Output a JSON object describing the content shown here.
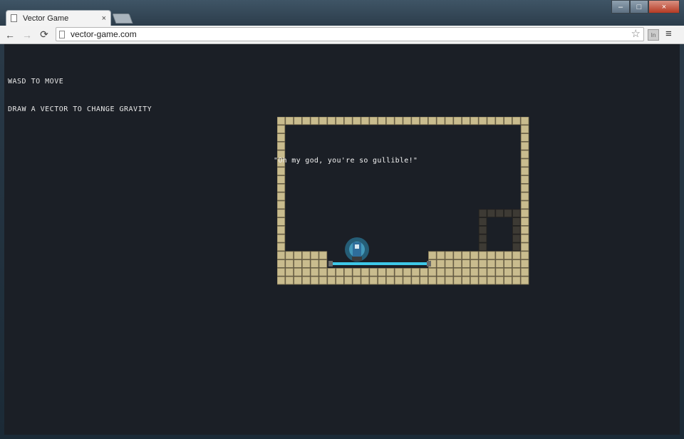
{
  "browser": {
    "tab_title": "Vector Game",
    "close_glyph": "×",
    "url": "vector-game.com",
    "back_glyph": "←",
    "forward_glyph": "→",
    "reload_glyph": "⟳",
    "star_glyph": "☆",
    "menu_glyph": "≡",
    "ext_label": "In",
    "window_controls": {
      "minimize": "–",
      "maximize": "□",
      "close": "×"
    }
  },
  "game": {
    "instructions": [
      "WASD TO MOVE",
      "DRAW A VECTOR TO CHANGE GRAVITY"
    ],
    "dialogue": "\"Oh my god, you're so gullible!\"",
    "colors": {
      "background": "#1b1f26",
      "tile": "#c9bc8e",
      "tile_edge": "#7d7150",
      "dark_tile": "#3d3a34",
      "platform": "#3ec8e8",
      "player": "#3aa0c8"
    }
  }
}
